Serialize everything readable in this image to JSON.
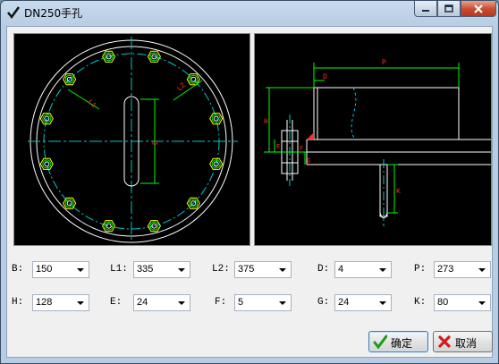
{
  "window": {
    "title": "DN250手孔"
  },
  "params": [
    {
      "label": "B:",
      "value": "150"
    },
    {
      "label": "L1:",
      "value": "335"
    },
    {
      "label": "L2:",
      "value": "375"
    },
    {
      "label": "D:",
      "value": "4"
    },
    {
      "label": "P:",
      "value": "273"
    },
    {
      "label": "H:",
      "value": "128"
    },
    {
      "label": "E:",
      "value": "24"
    },
    {
      "label": "F:",
      "value": "5"
    },
    {
      "label": "G:",
      "value": "24"
    },
    {
      "label": "K:",
      "value": "80"
    }
  ],
  "drawing_labels": {
    "l1": "L1",
    "l2": "L2",
    "b": "B",
    "p": "P",
    "d": "D",
    "h": "H",
    "e": "E",
    "f": "F",
    "g": "G",
    "k": "K"
  },
  "buttons": {
    "ok": "确定",
    "cancel": "取消"
  },
  "icons": {
    "app": "checkmark-app-icon",
    "ok": "green-check-icon",
    "cancel": "red-x-icon"
  },
  "colors": {
    "drawing_bg": "#000000",
    "outline": "#ffffff",
    "dim": "#00ff00",
    "center": "#00c8c8",
    "bolt": "#ffff00",
    "hidden": "#00c8ff",
    "weld": "#ff3030"
  }
}
